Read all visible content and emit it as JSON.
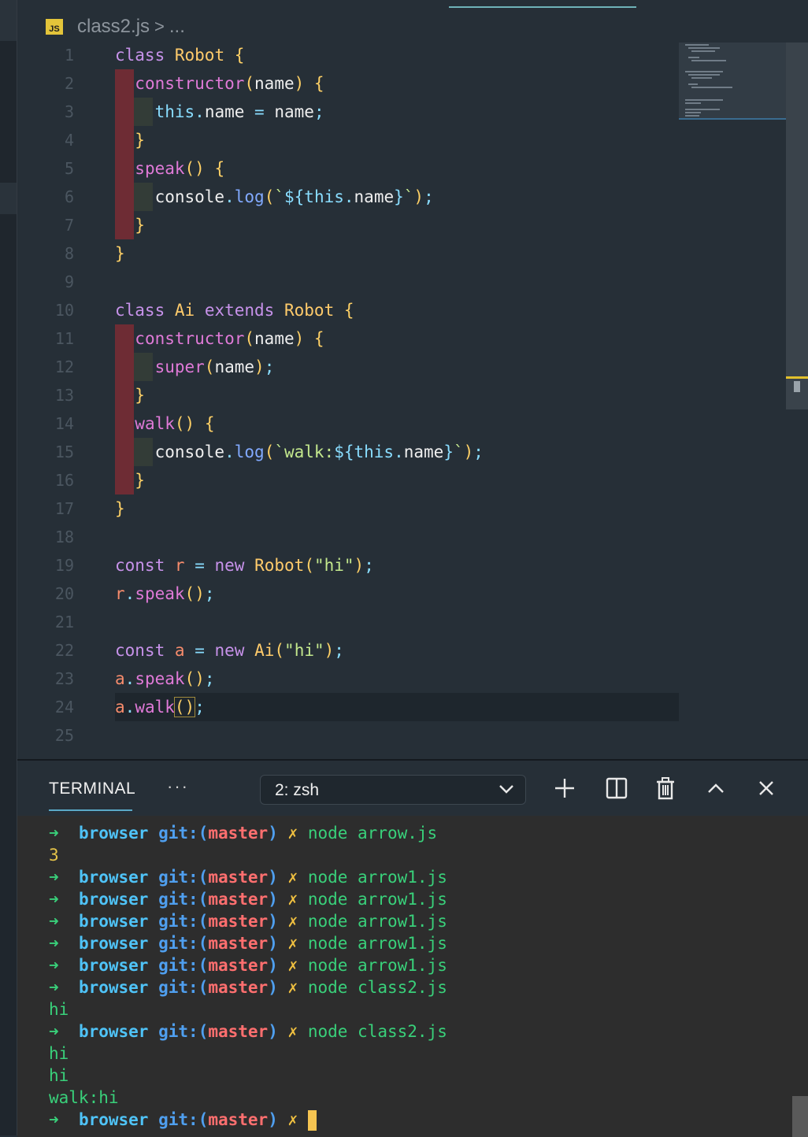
{
  "breadcrumb": {
    "file_icon": "JS",
    "file": "class2.js",
    "separator": ">",
    "ellipsis": "..."
  },
  "editor": {
    "line_numbers": [
      "1",
      "2",
      "3",
      "4",
      "5",
      "6",
      "7",
      "8",
      "9",
      "10",
      "11",
      "12",
      "13",
      "14",
      "15",
      "16",
      "17",
      "18",
      "19",
      "20",
      "21",
      "22",
      "23",
      "24",
      "25"
    ],
    "code_lines": [
      "class Robot {",
      "  constructor(name) {",
      "    this.name = name;",
      "  }",
      "  speak() {",
      "    console.log(`${this.name}`);",
      "  }",
      "}",
      "",
      "class Ai extends Robot {",
      "  constructor(name) {",
      "    super(name);",
      "  }",
      "  walk() {",
      "    console.log(`walk:${this.name}`);",
      "  }",
      "}",
      "",
      "const r = new Robot(\"hi\");",
      "r.speak();",
      "",
      "const a = new Ai(\"hi\");",
      "a.speak();",
      "a.walk();",
      ""
    ]
  },
  "panel": {
    "tab_label": "TERMINAL",
    "more_label": "···",
    "terminal_select": "2: zsh",
    "actions": [
      "plus-icon",
      "split-icon",
      "trash-icon",
      "chevron-up-icon",
      "close-icon"
    ]
  },
  "terminal": {
    "prompt": {
      "arrow": "➜",
      "dir": "browser",
      "git_prefix": "git:(",
      "branch": "master",
      "git_suffix": ")",
      "dirty": "✗"
    },
    "lines": [
      {
        "kind": "prompt",
        "command": "node arrow.js"
      },
      {
        "kind": "output",
        "text": "3"
      },
      {
        "kind": "prompt",
        "command": "node arrow1.js"
      },
      {
        "kind": "prompt",
        "command": "node arrow1.js"
      },
      {
        "kind": "prompt",
        "command": "node arrow1.js"
      },
      {
        "kind": "prompt",
        "command": "node arrow1.js"
      },
      {
        "kind": "prompt",
        "command": "node arrow1.js"
      },
      {
        "kind": "prompt",
        "command": "node class2.js"
      },
      {
        "kind": "output",
        "text": "hi"
      },
      {
        "kind": "prompt",
        "command": "node class2.js"
      },
      {
        "kind": "output",
        "text": "hi"
      },
      {
        "kind": "output",
        "text": "hi"
      },
      {
        "kind": "output",
        "text": "walk:hi"
      },
      {
        "kind": "prompt",
        "command": ""
      }
    ]
  },
  "colors": {
    "accent": "#5aa9c7",
    "branch": "#ff6f6f",
    "ok": "#39d07a",
    "cursor": "#f5c451"
  }
}
